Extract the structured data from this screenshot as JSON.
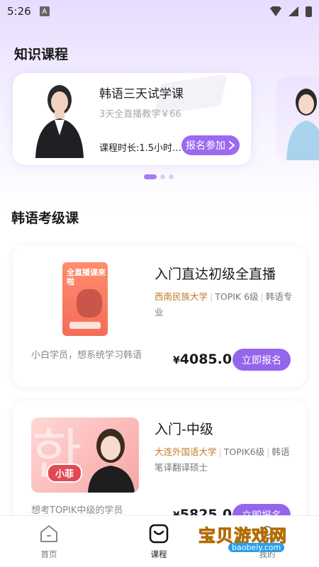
{
  "status_bar": {
    "time": "5:26",
    "app_icon": "A"
  },
  "knowledge": {
    "section_title": "知识课程",
    "card": {
      "title": "韩语三天试学课",
      "subtitle": "3天全直播教学￥66",
      "duration": "课程时长:1.5小时…",
      "button": "报名参加",
      "button_icon": "chevron-right-icon"
    },
    "carousel": {
      "count": 3,
      "active": 0
    }
  },
  "exam": {
    "section_title": "韩语考级课",
    "courses": [
      {
        "title": "入门直达初级全直播",
        "school": "西南民族大学",
        "tag2": "TOPIK 6级",
        "tag3": "韩语专业",
        "desc": "小白学员，想系统学习韩语",
        "price_symbol": "¥",
        "price": "4085.0",
        "button": "立即报名",
        "cover_text": "全直播课来啦"
      },
      {
        "title": "入门-中级",
        "school": "大连外国语大学",
        "tag2": "TOPIK6级",
        "tag3": "韩语笔译翻译硕士",
        "desc": "想考TOPIK中级的学员",
        "price_symbol": "¥",
        "price": "5825.0",
        "button": "立即报名",
        "cover_glyph": "한",
        "cover_name": "小菲"
      }
    ]
  },
  "bottom_nav": [
    {
      "label": "首页",
      "icon": "home-icon",
      "active": false
    },
    {
      "label": "课程",
      "icon": "course-icon",
      "active": true
    },
    {
      "label": "我的",
      "icon": "profile-icon",
      "active": false
    }
  ],
  "watermark": {
    "title": "宝贝游戏网",
    "url": "baobeiy.com"
  },
  "colors": {
    "accent": "#9565ee",
    "school": "#c27b2d"
  }
}
